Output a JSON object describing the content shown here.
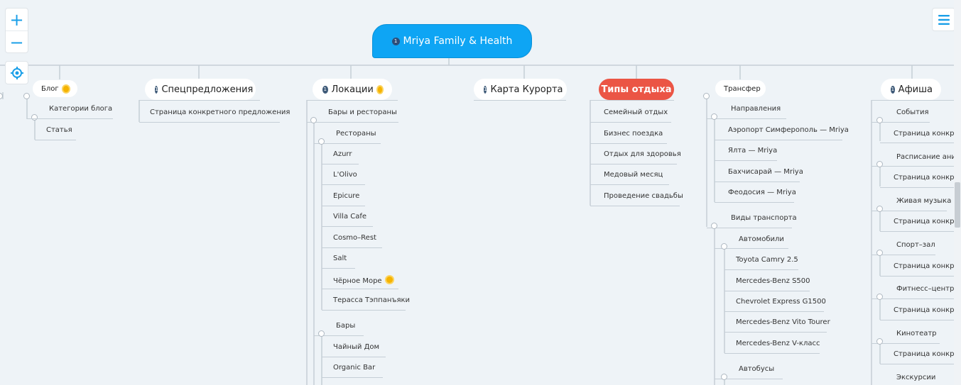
{
  "controls": {
    "zoom_in": "+",
    "zoom_out": "−"
  },
  "root": {
    "badge": "1",
    "label": "Mriya Family & Health"
  },
  "branches": {
    "blog": {
      "label": "Блог",
      "items": [
        "Категории блога",
        "Статья"
      ]
    },
    "offers": {
      "badge": "1",
      "label": "Спецпредложения",
      "items": [
        "Страница конкретного предложения"
      ]
    },
    "locations": {
      "badge": "1",
      "label": "Локации",
      "bars_restaurants": "Бары и рестораны",
      "restaurants": "Рестораны",
      "restaurant_items": [
        "Azurr",
        "L'Olivo",
        "Epicure",
        "Villa Cafe",
        "Cosmo–Rest",
        "Salt",
        "Чёрное Море",
        "Терасса Тэппанъяки"
      ],
      "bars": "Бары",
      "bar_items": [
        "Чайный Дом",
        "Organic Bar"
      ]
    },
    "map": {
      "badge": "1",
      "label": "Карта Курорта"
    },
    "types": {
      "label": "Типы отдыха",
      "items": [
        "Семейный отдых",
        "Бизнес поездка",
        "Отдых для здоровья",
        "Медовый месяц",
        "Проведение свадьбы"
      ]
    },
    "transfer": {
      "label": "Трансфер",
      "directions": "Направления",
      "direction_items": [
        "Аэропорт Симферополь — Mriya",
        "Ялта — Mriya",
        "Бахчисарай — Mriya",
        "Феодосия — Mriya"
      ],
      "transport": "Виды транспорта",
      "cars": "Автомобили",
      "car_items": [
        "Toyota Camry 2.5",
        "Mercedes-Benz S500",
        "Chevrolet Express G1500",
        "Mercedes-Benz Vito Tourer",
        "Mercedes-Benz V-класс"
      ],
      "buses": "Автобусы"
    },
    "afisha": {
      "badge": "1",
      "label": "Афиша",
      "groups": [
        {
          "label": "События",
          "item": "Страница конкрет"
        },
        {
          "label": "Расписание аним",
          "item": "Страница конкрет"
        },
        {
          "label": "Живая музыка",
          "item": "Страница конкрет"
        },
        {
          "label": "Спорт–зал",
          "item": "Страница конкрет"
        },
        {
          "label": "Фитнесс–центр",
          "item": "Страница конкрет"
        },
        {
          "label": "Кинотеатр",
          "item": "Страница конкрет"
        },
        {
          "label": "Экскурсии"
        }
      ]
    }
  }
}
